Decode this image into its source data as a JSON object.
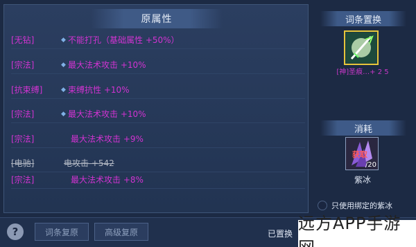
{
  "panel": {
    "title": "原属性",
    "rows": [
      {
        "tag": "[无钻]",
        "text": "不能打孔（基础属性 +50%）",
        "dot": "◆"
      },
      {
        "tag": "[宗法]",
        "text": "最大法术攻击 +10%",
        "dot": "◆"
      },
      {
        "tag": "[抗束缚]",
        "text": "束缚抗性 +10%",
        "dot": "◆"
      },
      {
        "tag": "[宗法]",
        "text": "最大法术攻击 +10%",
        "dot": "◆"
      },
      {
        "tag": "[宗法]",
        "text": "最大法术攻击 +9%"
      },
      {
        "tag": "[电驰]",
        "text": "电攻击 +542"
      },
      {
        "tag": "[宗法]",
        "text": "最大法术攻击 +8%"
      }
    ]
  },
  "replace": {
    "title": "词条置换",
    "item_caption": "[神]圣痕…+ 2 5"
  },
  "cost": {
    "title": "消耗",
    "get_label": "获取",
    "quantity": "/20",
    "item_name": "紫冰",
    "bind_option": "只使用绑定的紫冰"
  },
  "bottom": {
    "help": "?",
    "restore_label": "词条复原",
    "advanced_restore_label": "高级复原",
    "status": "已置换",
    "watermark": "远方APP手游网"
  },
  "colors": {
    "purple_attr": "#d233d2",
    "strike_gray": "#b0b6c2",
    "item_border": "#e6c63a"
  }
}
